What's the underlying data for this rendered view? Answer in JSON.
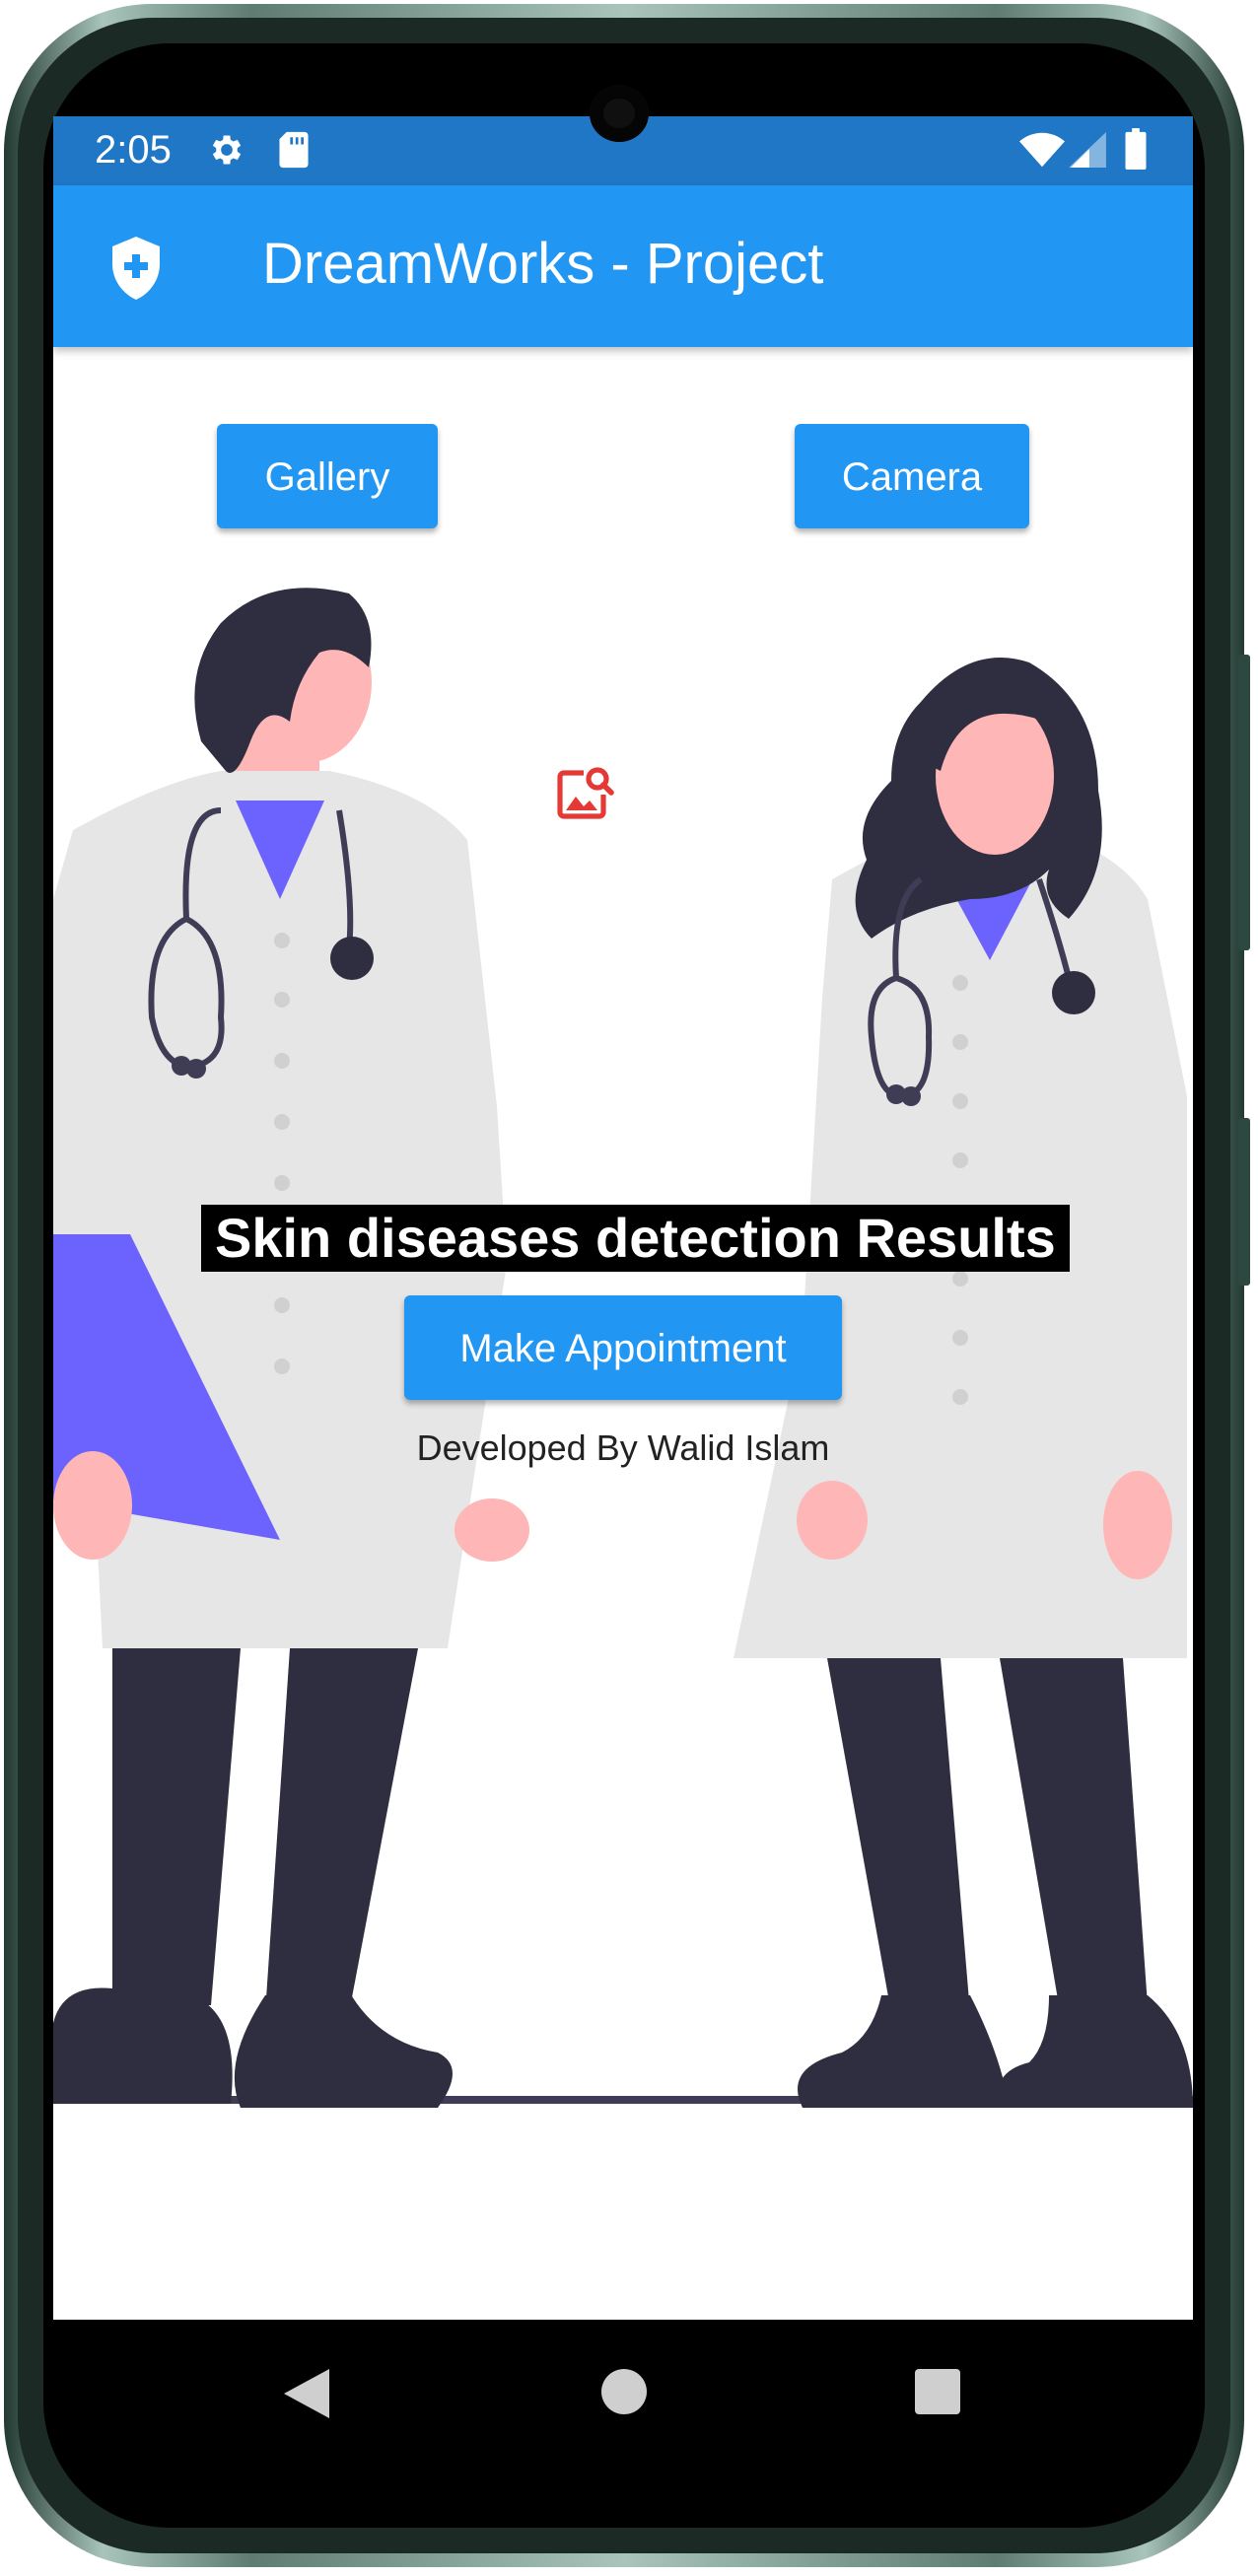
{
  "status_bar": {
    "time": "2:05",
    "icons": [
      "gear-icon",
      "sd-card-icon",
      "wifi-icon",
      "signal-icon",
      "battery-icon"
    ]
  },
  "app_bar": {
    "title": "DreamWorks - Project",
    "logo_icon": "medical-shield-icon"
  },
  "actions": {
    "gallery_label": "Gallery",
    "camera_label": "Camera",
    "appointment_label": "Make Appointment"
  },
  "result": {
    "title": "Skin diseases detection Results",
    "image_icon": "image-search-icon"
  },
  "footer": {
    "developer": "Developed By Walid Islam"
  },
  "nav_bar": {
    "icons": [
      "back-icon",
      "home-icon",
      "recents-icon"
    ]
  },
  "colors": {
    "primary": "#2196f3",
    "status_bar": "#1f77c6",
    "icon_red": "#e53935",
    "accent_purple": "#6c63ff",
    "dark_figure": "#2f2e41",
    "coat": "#e6e6e6",
    "skin": "#ffb6b6"
  }
}
